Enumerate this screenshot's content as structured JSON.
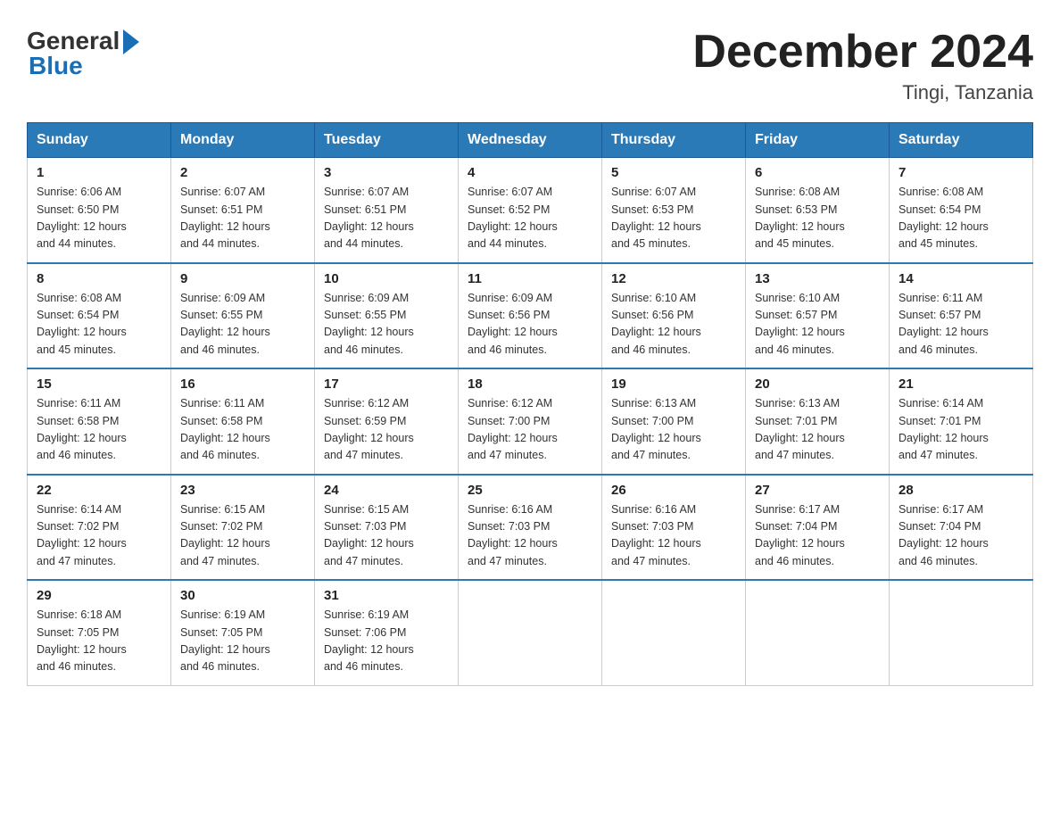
{
  "logo": {
    "general": "General",
    "blue": "Blue"
  },
  "title": "December 2024",
  "location": "Tingi, Tanzania",
  "days_of_week": [
    "Sunday",
    "Monday",
    "Tuesday",
    "Wednesday",
    "Thursday",
    "Friday",
    "Saturday"
  ],
  "weeks": [
    [
      {
        "day": "1",
        "sunrise": "6:06 AM",
        "sunset": "6:50 PM",
        "daylight": "12 hours and 44 minutes."
      },
      {
        "day": "2",
        "sunrise": "6:07 AM",
        "sunset": "6:51 PM",
        "daylight": "12 hours and 44 minutes."
      },
      {
        "day": "3",
        "sunrise": "6:07 AM",
        "sunset": "6:51 PM",
        "daylight": "12 hours and 44 minutes."
      },
      {
        "day": "4",
        "sunrise": "6:07 AM",
        "sunset": "6:52 PM",
        "daylight": "12 hours and 44 minutes."
      },
      {
        "day": "5",
        "sunrise": "6:07 AM",
        "sunset": "6:53 PM",
        "daylight": "12 hours and 45 minutes."
      },
      {
        "day": "6",
        "sunrise": "6:08 AM",
        "sunset": "6:53 PM",
        "daylight": "12 hours and 45 minutes."
      },
      {
        "day": "7",
        "sunrise": "6:08 AM",
        "sunset": "6:54 PM",
        "daylight": "12 hours and 45 minutes."
      }
    ],
    [
      {
        "day": "8",
        "sunrise": "6:08 AM",
        "sunset": "6:54 PM",
        "daylight": "12 hours and 45 minutes."
      },
      {
        "day": "9",
        "sunrise": "6:09 AM",
        "sunset": "6:55 PM",
        "daylight": "12 hours and 46 minutes."
      },
      {
        "day": "10",
        "sunrise": "6:09 AM",
        "sunset": "6:55 PM",
        "daylight": "12 hours and 46 minutes."
      },
      {
        "day": "11",
        "sunrise": "6:09 AM",
        "sunset": "6:56 PM",
        "daylight": "12 hours and 46 minutes."
      },
      {
        "day": "12",
        "sunrise": "6:10 AM",
        "sunset": "6:56 PM",
        "daylight": "12 hours and 46 minutes."
      },
      {
        "day": "13",
        "sunrise": "6:10 AM",
        "sunset": "6:57 PM",
        "daylight": "12 hours and 46 minutes."
      },
      {
        "day": "14",
        "sunrise": "6:11 AM",
        "sunset": "6:57 PM",
        "daylight": "12 hours and 46 minutes."
      }
    ],
    [
      {
        "day": "15",
        "sunrise": "6:11 AM",
        "sunset": "6:58 PM",
        "daylight": "12 hours and 46 minutes."
      },
      {
        "day": "16",
        "sunrise": "6:11 AM",
        "sunset": "6:58 PM",
        "daylight": "12 hours and 46 minutes."
      },
      {
        "day": "17",
        "sunrise": "6:12 AM",
        "sunset": "6:59 PM",
        "daylight": "12 hours and 47 minutes."
      },
      {
        "day": "18",
        "sunrise": "6:12 AM",
        "sunset": "7:00 PM",
        "daylight": "12 hours and 47 minutes."
      },
      {
        "day": "19",
        "sunrise": "6:13 AM",
        "sunset": "7:00 PM",
        "daylight": "12 hours and 47 minutes."
      },
      {
        "day": "20",
        "sunrise": "6:13 AM",
        "sunset": "7:01 PM",
        "daylight": "12 hours and 47 minutes."
      },
      {
        "day": "21",
        "sunrise": "6:14 AM",
        "sunset": "7:01 PM",
        "daylight": "12 hours and 47 minutes."
      }
    ],
    [
      {
        "day": "22",
        "sunrise": "6:14 AM",
        "sunset": "7:02 PM",
        "daylight": "12 hours and 47 minutes."
      },
      {
        "day": "23",
        "sunrise": "6:15 AM",
        "sunset": "7:02 PM",
        "daylight": "12 hours and 47 minutes."
      },
      {
        "day": "24",
        "sunrise": "6:15 AM",
        "sunset": "7:03 PM",
        "daylight": "12 hours and 47 minutes."
      },
      {
        "day": "25",
        "sunrise": "6:16 AM",
        "sunset": "7:03 PM",
        "daylight": "12 hours and 47 minutes."
      },
      {
        "day": "26",
        "sunrise": "6:16 AM",
        "sunset": "7:03 PM",
        "daylight": "12 hours and 47 minutes."
      },
      {
        "day": "27",
        "sunrise": "6:17 AM",
        "sunset": "7:04 PM",
        "daylight": "12 hours and 46 minutes."
      },
      {
        "day": "28",
        "sunrise": "6:17 AM",
        "sunset": "7:04 PM",
        "daylight": "12 hours and 46 minutes."
      }
    ],
    [
      {
        "day": "29",
        "sunrise": "6:18 AM",
        "sunset": "7:05 PM",
        "daylight": "12 hours and 46 minutes."
      },
      {
        "day": "30",
        "sunrise": "6:19 AM",
        "sunset": "7:05 PM",
        "daylight": "12 hours and 46 minutes."
      },
      {
        "day": "31",
        "sunrise": "6:19 AM",
        "sunset": "7:06 PM",
        "daylight": "12 hours and 46 minutes."
      },
      null,
      null,
      null,
      null
    ]
  ]
}
